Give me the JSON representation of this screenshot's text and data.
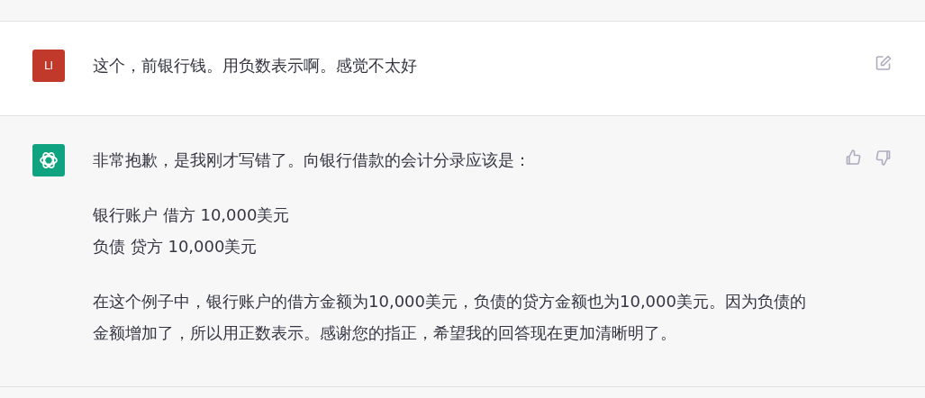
{
  "messages": [
    {
      "kind": "user",
      "avatar": "LI",
      "paragraphs": [
        {
          "lines": [
            "这个，前银行钱。用负数表示啊。感觉不太好"
          ]
        }
      ]
    },
    {
      "kind": "assistant",
      "paragraphs": [
        {
          "lines": [
            "非常抱歉，是我刚才写错了。向银行借款的会计分录应该是："
          ]
        },
        {
          "lines": [
            "银行账户 借方 10,000美元",
            "负债 贷方 10,000美元"
          ]
        },
        {
          "lines": [
            "在这个例子中，银行账户的借方金额为10,000美元，负债的贷方金额也为10,000美元。因为负债的金额增加了，所以用正数表示。感谢您的指正，希望我的回答现在更加清晰明了。"
          ]
        }
      ]
    }
  ]
}
